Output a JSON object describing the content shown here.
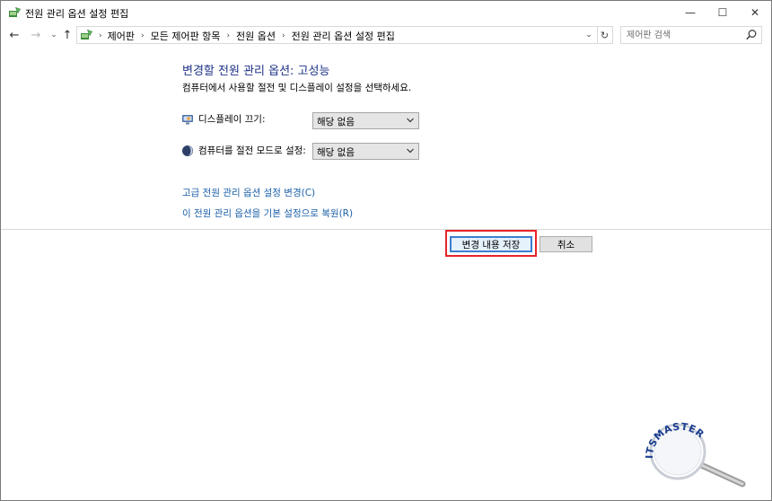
{
  "window": {
    "title": "전원 관리 옵션 설정 편집",
    "minimize_glyph": "—",
    "maximize_glyph": "☐",
    "close_glyph": "✕"
  },
  "nav": {
    "back_glyph": "←",
    "forward_glyph": "→",
    "recent_glyph": "⌄",
    "up_glyph": "↑",
    "address_dropdown_glyph": "⌄",
    "refresh_glyph": "↻",
    "breadcrumbs": [
      "제어판",
      "모든 제어판 항목",
      "전원 옵션",
      "전원 관리 옵션 설정 편집"
    ]
  },
  "search": {
    "placeholder": "제어판 검색"
  },
  "main": {
    "heading": "변경할 전원 관리 옵션: 고성능",
    "description": "컴퓨터에서 사용할 절전 및 디스플레이 설정을 선택하세요.",
    "display_off": {
      "label": "디스플레이 끄기:",
      "value": "해당 없음"
    },
    "sleep": {
      "label": "컴퓨터를 절전 모드로 설정:",
      "value": "해당 없음"
    },
    "advanced_link": "고급 전원 관리 옵션 설정 변경(C)",
    "restore_link": "이 전원 관리 옵션을 기본 설정으로 복원(R)"
  },
  "buttons": {
    "save": "변경 내용 저장",
    "cancel": "취소"
  },
  "colors": {
    "heading": "#1e3287",
    "link": "#1b5fa8",
    "highlight_frame": "#e8232a",
    "default_button_border": "#3c7fd1"
  },
  "watermark": {
    "text": "ITSMASTER"
  }
}
